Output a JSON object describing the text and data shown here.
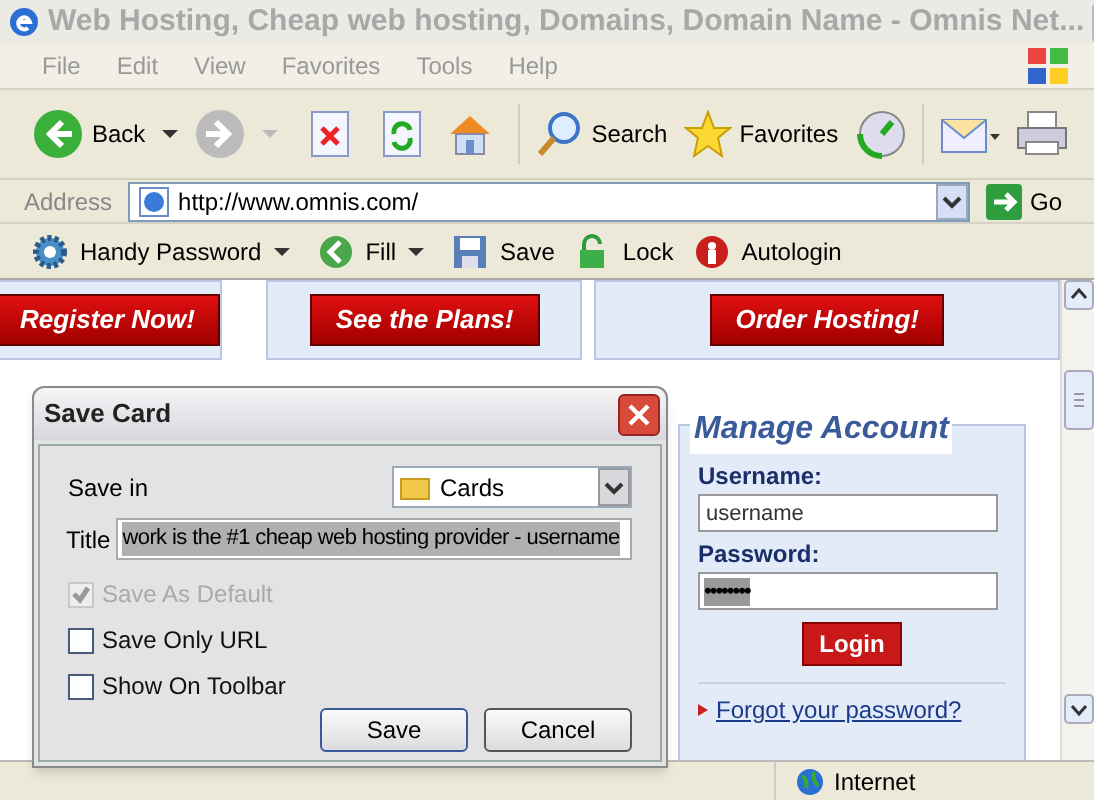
{
  "window": {
    "title": "Web Hosting, Cheap web hosting, Domains, Domain Name - Omnis Net..."
  },
  "menu": [
    "File",
    "Edit",
    "View",
    "Favorites",
    "Tools",
    "Help"
  ],
  "toolbar": {
    "back": "Back",
    "search": "Search",
    "favorites": "Favorites"
  },
  "address_bar": {
    "label": "Address",
    "url": "http://www.omnis.com/",
    "go": "Go"
  },
  "handy_toolbar": [
    {
      "kind": "menu",
      "label": "Handy Password"
    },
    {
      "kind": "fill",
      "label": "Fill"
    },
    {
      "kind": "save",
      "label": "Save"
    },
    {
      "kind": "lock",
      "label": "Lock"
    },
    {
      "kind": "autologin",
      "label": "Autologin"
    }
  ],
  "page": {
    "banners": [
      "Register Now!",
      "See the Plans!",
      "Order Hosting!"
    ],
    "manage_account": {
      "title": "Manage Account",
      "username_label": "Username:",
      "username": "username",
      "password_label": "Password:",
      "password": "••••••••",
      "login": "Login",
      "link": "Forgot your password?"
    }
  },
  "dialog": {
    "title": "Save Card",
    "save_in_label": "Save in",
    "save_in": "Cards",
    "title_label": "Title",
    "title_value": "work is the #1 cheap web hosting provider - username",
    "options": [
      {
        "label": "Save As Default",
        "checked": true,
        "disabled": true
      },
      {
        "label": "Save Only URL",
        "checked": false,
        "disabled": false
      },
      {
        "label": "Show On Toolbar",
        "checked": false,
        "disabled": false
      }
    ],
    "buttons": [
      "Save",
      "Cancel"
    ]
  },
  "status_bar": {
    "zone": "Internet"
  }
}
